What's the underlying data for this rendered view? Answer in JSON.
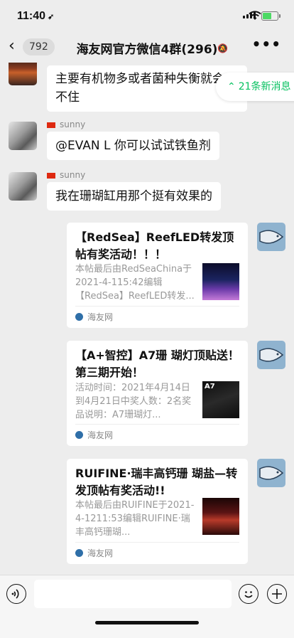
{
  "status_bar": {
    "time": "11:40",
    "location_glyph": "➶"
  },
  "nav": {
    "back_count": "792",
    "title": "海友网官方微信4群(296)",
    "more_label": "•••"
  },
  "new_messages": {
    "label": "21条新消息"
  },
  "messages": [
    {
      "type": "text",
      "sender": "",
      "text": "主要有机物多或者菌种失衡就会\n不住"
    },
    {
      "type": "text",
      "sender": "sunny",
      "text": "@EVAN L 你可以试试铁鱼剂"
    },
    {
      "type": "text",
      "sender": "sunny",
      "text": "我在珊瑚缸用那个挺有效果的"
    }
  ],
  "cards": [
    {
      "title": "【RedSea】ReefLED转发顶帖有奖活动！！！",
      "desc": "本帖最后由RedSeaChina于2021-4-115:42编辑【RedSea】ReefLED转发...",
      "source": "海友网",
      "thumb_text": ""
    },
    {
      "title": "【A+智控】A7珊 瑚灯顶贴送！第三期开始！",
      "desc": "活动时间：2021年4月14日到4月21日中奖人数：2名奖品说明：A7珊瑚灯...",
      "source": "海友网",
      "thumb_text": "A7"
    },
    {
      "title": "RUIFINE·瑞丰高钙珊 瑚盐—转发顶帖有奖活动!!",
      "desc": "本帖最后由RUIFINE于2021-4-1211:53编辑RUIFINE·瑞丰高钙珊瑚...",
      "source": "海友网",
      "thumb_text": ""
    }
  ],
  "colors": {
    "accent_green": "#07c160",
    "bubble": "#ffffff",
    "background": "#ededed"
  },
  "input": {
    "voice_icon": "voice-icon",
    "emoji_icon": "emoji-icon",
    "plus_icon": "plus-icon"
  }
}
